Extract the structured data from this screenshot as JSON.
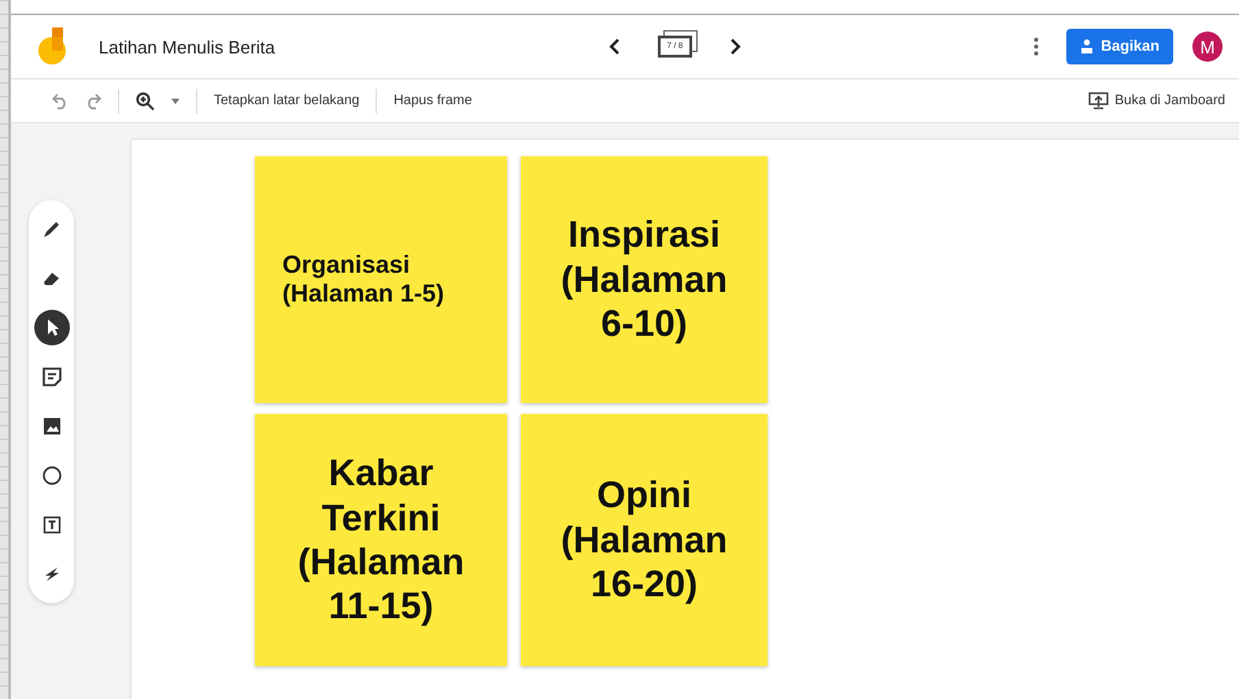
{
  "header": {
    "title": "Latihan Menulis Berita",
    "frame_counter": "7 / 8",
    "share_button": "Bagikan",
    "avatar": "M"
  },
  "toolbar": {
    "items": [
      {
        "label": "Tetapkan latar belakang"
      },
      {
        "label": "Hapus frame"
      }
    ],
    "open_button": "Buka di Jamboard"
  },
  "tools": [
    {
      "kind": "pen",
      "selected": false
    },
    {
      "kind": "eraser",
      "selected": false
    },
    {
      "kind": "select",
      "selected": true
    },
    {
      "kind": "sticky",
      "selected": false
    },
    {
      "kind": "image",
      "selected": false
    },
    {
      "kind": "circle",
      "selected": false
    },
    {
      "kind": "textbox",
      "selected": false
    },
    {
      "kind": "laser",
      "selected": false
    }
  ],
  "notes": [
    {
      "text": "Organisasi (Halaman 1-5)",
      "kind": "small"
    },
    {
      "text": "Inspirasi (Halaman 6-10)",
      "kind": "large"
    },
    {
      "text": "Kabar Terkini (Halaman 11-15)",
      "kind": "large"
    },
    {
      "text": "Opini (Halaman 16-20)",
      "kind": "large"
    }
  ]
}
